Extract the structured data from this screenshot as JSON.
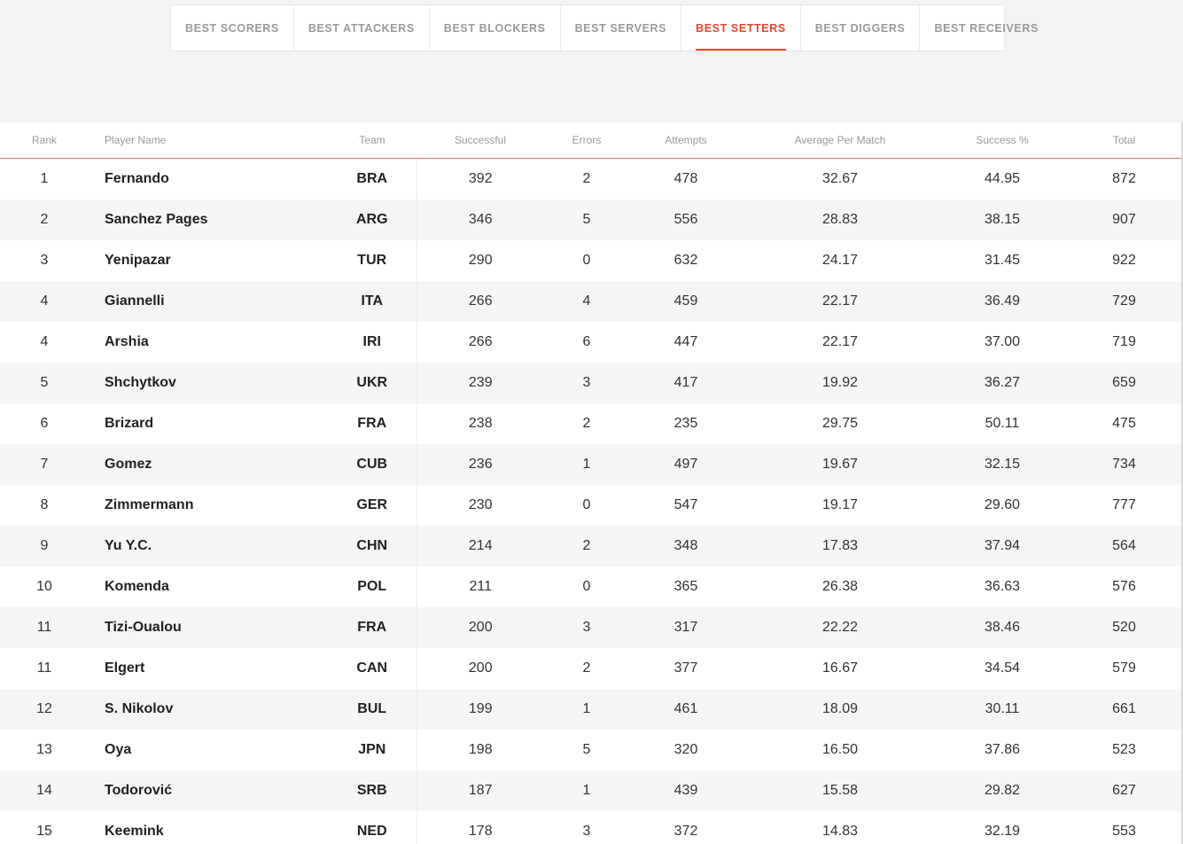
{
  "tabs": [
    {
      "label": "BEST SCORERS",
      "active": false
    },
    {
      "label": "BEST ATTACKERS",
      "active": false
    },
    {
      "label": "BEST BLOCKERS",
      "active": false
    },
    {
      "label": "BEST SERVERS",
      "active": false
    },
    {
      "label": "BEST SETTERS",
      "active": true
    },
    {
      "label": "BEST DIGGERS",
      "active": false
    },
    {
      "label": "BEST RECEIVERS",
      "active": false
    }
  ],
  "colors": {
    "accent": "#e8452c",
    "header_rule": "#d9745f",
    "row_alt": "#f5f5f5"
  },
  "table": {
    "columns": [
      "Rank",
      "Player Name",
      "Team",
      "Successful",
      "Errors",
      "Attempts",
      "Average Per Match",
      "Success %",
      "Total"
    ],
    "rows": [
      [
        "1",
        "Fernando",
        "BRA",
        "392",
        "2",
        "478",
        "32.67",
        "44.95",
        "872"
      ],
      [
        "2",
        "Sanchez Pages",
        "ARG",
        "346",
        "5",
        "556",
        "28.83",
        "38.15",
        "907"
      ],
      [
        "3",
        "Yenipazar",
        "TUR",
        "290",
        "0",
        "632",
        "24.17",
        "31.45",
        "922"
      ],
      [
        "4",
        "Giannelli",
        "ITA",
        "266",
        "4",
        "459",
        "22.17",
        "36.49",
        "729"
      ],
      [
        "4",
        "Arshia",
        "IRI",
        "266",
        "6",
        "447",
        "22.17",
        "37.00",
        "719"
      ],
      [
        "5",
        "Shchytkov",
        "UKR",
        "239",
        "3",
        "417",
        "19.92",
        "36.27",
        "659"
      ],
      [
        "6",
        "Brizard",
        "FRA",
        "238",
        "2",
        "235",
        "29.75",
        "50.11",
        "475"
      ],
      [
        "7",
        "Gomez",
        "CUB",
        "236",
        "1",
        "497",
        "19.67",
        "32.15",
        "734"
      ],
      [
        "8",
        "Zimmermann",
        "GER",
        "230",
        "0",
        "547",
        "19.17",
        "29.60",
        "777"
      ],
      [
        "9",
        "Yu Y.C.",
        "CHN",
        "214",
        "2",
        "348",
        "17.83",
        "37.94",
        "564"
      ],
      [
        "10",
        "Komenda",
        "POL",
        "211",
        "0",
        "365",
        "26.38",
        "36.63",
        "576"
      ],
      [
        "11",
        "Tizi-Oualou",
        "FRA",
        "200",
        "3",
        "317",
        "22.22",
        "38.46",
        "520"
      ],
      [
        "11",
        "Elgert",
        "CAN",
        "200",
        "2",
        "377",
        "16.67",
        "34.54",
        "579"
      ],
      [
        "12",
        "S. Nikolov",
        "BUL",
        "199",
        "1",
        "461",
        "18.09",
        "30.11",
        "661"
      ],
      [
        "13",
        "Oya",
        "JPN",
        "198",
        "5",
        "320",
        "16.50",
        "37.86",
        "523"
      ],
      [
        "14",
        "Todorović",
        "SRB",
        "187",
        "1",
        "439",
        "15.58",
        "29.82",
        "627"
      ],
      [
        "15",
        "Keemink",
        "NED",
        "178",
        "3",
        "372",
        "14.83",
        "32.19",
        "553"
      ]
    ]
  }
}
